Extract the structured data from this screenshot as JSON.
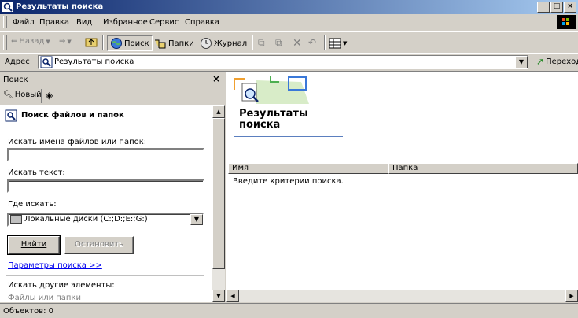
{
  "window": {
    "title": "Результаты поиска"
  },
  "menubar": {
    "items": [
      "Файл",
      "Правка",
      "Вид",
      "Избранное",
      "Сервис",
      "Справка"
    ]
  },
  "toolbar": {
    "back": "Назад",
    "search": "Поиск",
    "folders": "Папки",
    "history": "Журнал"
  },
  "address": {
    "label": "Адрес",
    "value": "Результаты поиска",
    "go": "Переход"
  },
  "search_pane": {
    "header": "Поиск",
    "close": "×",
    "new_button": "Новый",
    "section_title": "Поиск файлов и папок",
    "names_label": "Искать имена файлов или папок:",
    "names_value": "",
    "text_label": "Искать текст:",
    "text_value": "",
    "location_label": "Где искать:",
    "location_value": "Локальные диски (C:;D:;E:;G:)",
    "find_button": "Найти",
    "stop_button": "Остановить",
    "options_link": "Параметры поиска >>",
    "other_label": "Искать другие элементы:",
    "other_link": "Файлы или папки"
  },
  "results": {
    "title_line1": "Результаты",
    "title_line2": "поиска",
    "columns": [
      "Имя",
      "Папка"
    ],
    "message": "Введите критерии поиска."
  },
  "status": {
    "text": "Объектов: 0"
  },
  "colors": {
    "face": "#d4d0c8",
    "title_start": "#0a246a",
    "title_end": "#a6caf0",
    "link": "#0000ee"
  }
}
